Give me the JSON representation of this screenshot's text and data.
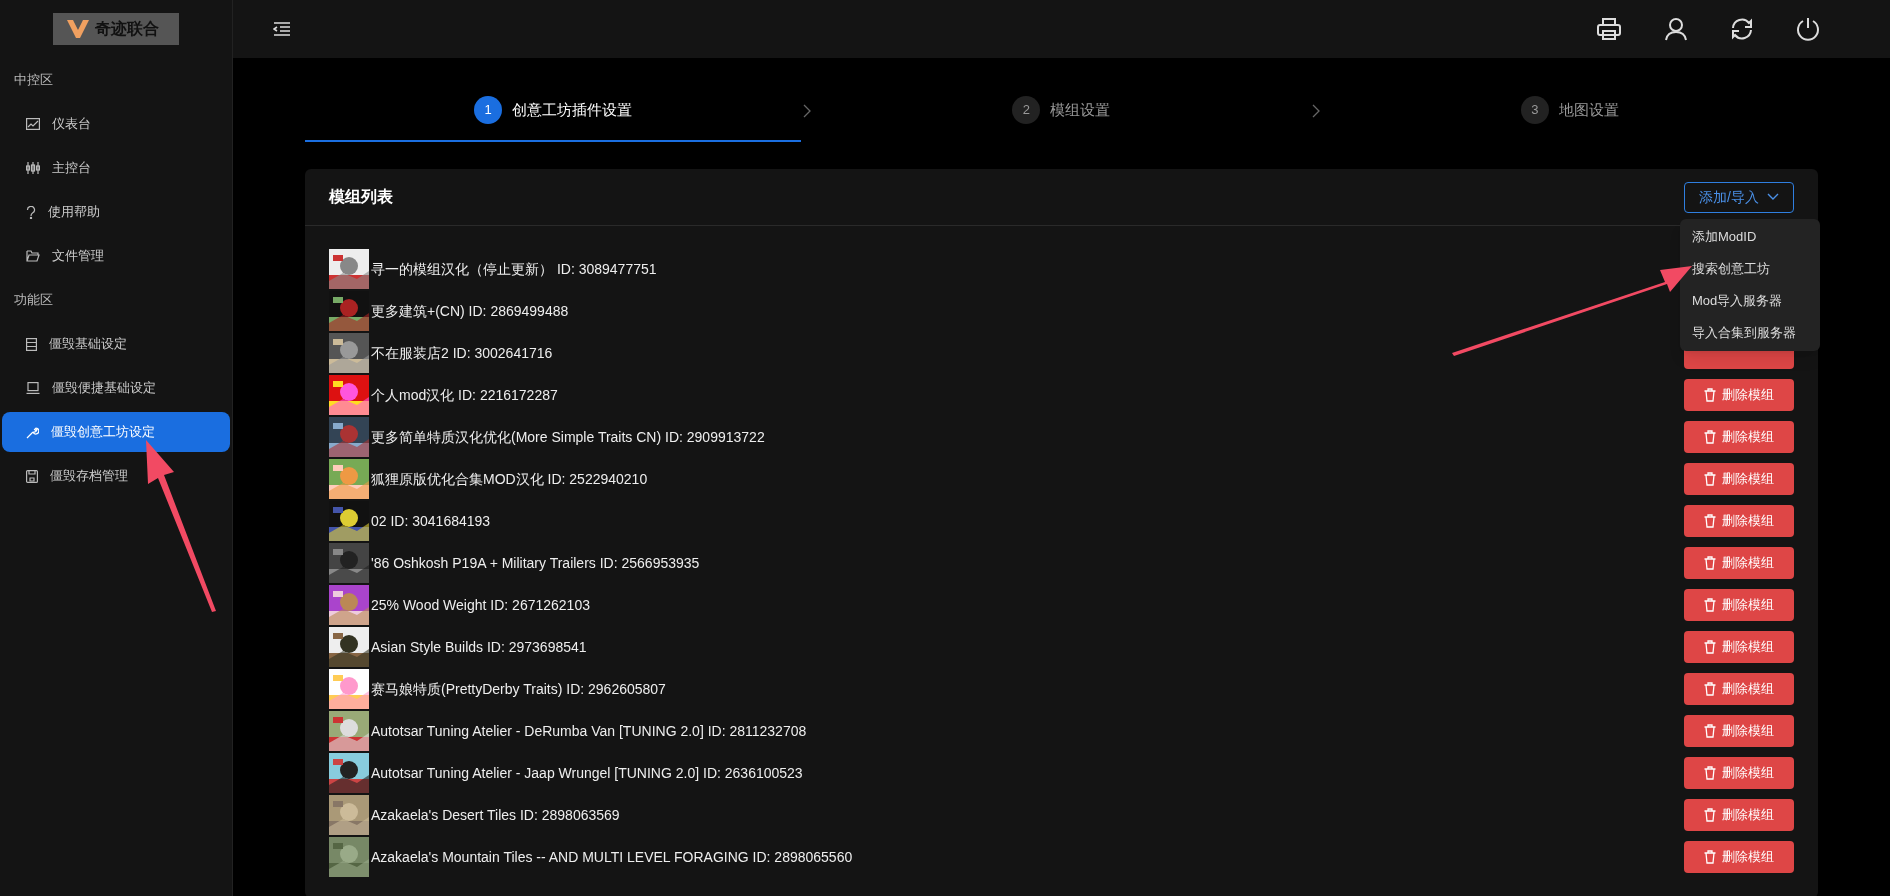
{
  "logo": {
    "text": "奇迹联合"
  },
  "sidebar": {
    "sections": [
      {
        "title": "中控区",
        "items": [
          {
            "label": "仪表台",
            "selected": false
          },
          {
            "label": "主控台",
            "selected": false
          },
          {
            "label": "使用帮助",
            "selected": false
          },
          {
            "label": "文件管理",
            "selected": false
          }
        ]
      },
      {
        "title": "功能区",
        "items": [
          {
            "label": "僵毁基础设定",
            "selected": false
          },
          {
            "label": "僵毁便捷基础设定",
            "selected": false
          },
          {
            "label": "僵毁创意工坊设定",
            "selected": true
          },
          {
            "label": "僵毁存档管理",
            "selected": false
          }
        ]
      }
    ]
  },
  "steps": [
    {
      "number": "1",
      "label": "创意工坊插件设置",
      "selected": true
    },
    {
      "number": "2",
      "label": "模组设置",
      "selected": false
    },
    {
      "number": "3",
      "label": "地图设置",
      "selected": false
    }
  ],
  "card": {
    "title": "模组列表",
    "add_button": "添加/导入",
    "dropdown": [
      "添加ModID",
      "搜索创意工坊",
      "Mod导入服务器",
      "导入合集到服务器"
    ],
    "rows": [
      {
        "text": "寻一的模组汉化（停止更新） ID: 3089477751"
      },
      {
        "text": "更多建筑+(CN) ID: 2869499488"
      },
      {
        "text": "不在服装店2 ID: 3002641716",
        "covered_button": true
      },
      {
        "text": "个人mod汉化 ID: 2216172287",
        "delete_button": "删除模组"
      },
      {
        "text": "更多简单特质汉化优化(More Simple Traits CN) ID: 2909913722",
        "delete_button": "删除模组"
      },
      {
        "text": "狐狸原版优化合集MOD汉化 ID: 2522940210",
        "delete_button": "删除模组"
      },
      {
        "text": "02 ID: 3041684193",
        "delete_button": "删除模组"
      },
      {
        "text": "'86 Oshkosh P19A + Military Trailers ID: 2566953935",
        "delete_button": "删除模组"
      },
      {
        "text": "25% Wood Weight ID: 2671262103",
        "delete_button": "删除模组"
      },
      {
        "text": "Asian Style Builds ID: 2973698541",
        "delete_button": "删除模组"
      },
      {
        "text": "赛马娘特质(PrettyDerby Traits) ID: 2962605807",
        "delete_button": "删除模组"
      },
      {
        "text": "Autotsar Tuning Atelier - DeRumba Van [TUNING 2.0] ID: 2811232708",
        "delete_button": "删除模组"
      },
      {
        "text": "Autotsar Tuning Atelier - Jaap Wrungel [TUNING 2.0] ID: 2636100523",
        "delete_button": "删除模组"
      },
      {
        "text": "Azakaela's Desert Tiles ID: 2898063569",
        "delete_button": "删除模组"
      },
      {
        "text": "Azakaela's Mountain Tiles -- AND MULTI LEVEL FORAGING ID: 2898065560",
        "delete_button": "删除模组"
      }
    ]
  }
}
